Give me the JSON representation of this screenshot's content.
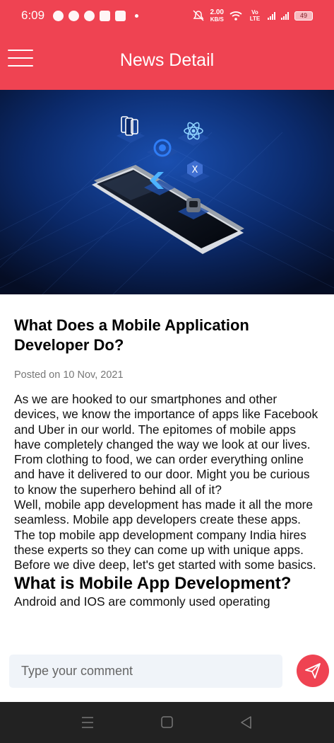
{
  "status_bar": {
    "time": "6:09",
    "net_speed_value": "2.00",
    "net_speed_unit": "KB/S",
    "network_type": "Vo LTE",
    "battery": "49"
  },
  "app_bar": {
    "title": "News Detail",
    "menu_icon": "hamburger-menu-icon"
  },
  "hero_image": {
    "description": "mobile-app-development-illustration",
    "background_color": "#0b2a6b"
  },
  "article": {
    "title": "What Does a Mobile Application Developer Do?",
    "posted": "Posted on 10 Nov, 2021",
    "paragraphs": [
      "As we are hooked to our smartphones and other devices, we know the importance of apps like Facebook and Uber in our world. The epitomes of mobile apps have completely changed the way we look at our lives.",
      "From clothing to food, we can order everything online and have it delivered to our door. Might you be curious to know the superhero behind all of it?",
      "Well, mobile app development has made it all the more seamless. Mobile app developers create these apps. The top mobile app development company India hires these experts so they can come up with unique apps. Before we dive deep, let's get started with some basics."
    ],
    "subheading": "What is Mobile App Development?",
    "subtext": "Android and IOS are commonly used operating"
  },
  "comment": {
    "placeholder": "Type your comment",
    "send_icon": "send-icon"
  },
  "colors": {
    "accent": "#ef4352",
    "input_bg": "#f0f4f9",
    "nav_bg": "#222222"
  }
}
